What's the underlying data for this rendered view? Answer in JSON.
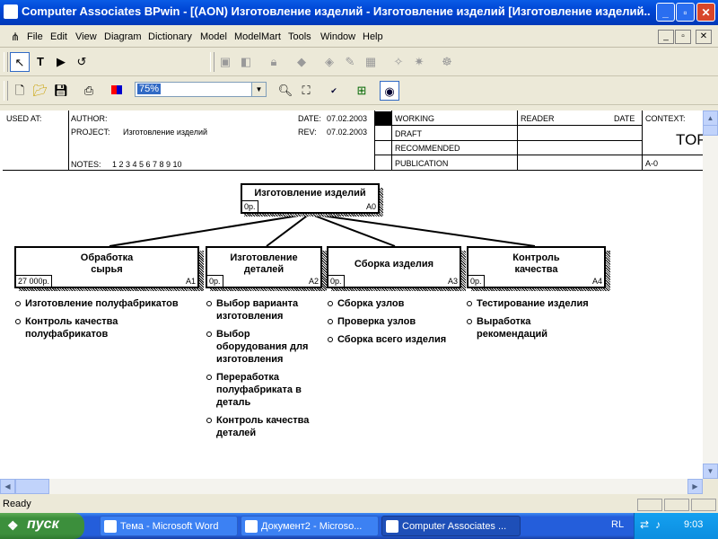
{
  "window": {
    "title": "Computer Associates BPwin - [(AON) Изготовление изделий - Изготовление изделий  [Изготовление изделий...",
    "minimize": "_",
    "maximize": "▫",
    "close": "✕"
  },
  "menu": {
    "items": [
      "File",
      "Edit",
      "View",
      "Diagram",
      "Dictionary",
      "Model",
      "ModelMart",
      "Tools",
      "Window",
      "Help"
    ],
    "mdi_min": "_",
    "mdi_restore": "▫",
    "mdi_close": "✕"
  },
  "toolbar2": {
    "zoom": "75%"
  },
  "header": {
    "used_at": "USED AT:",
    "author": "AUTHOR:",
    "project_label": "PROJECT:",
    "project": "Изготовление изделий",
    "notes_label": "NOTES:",
    "notes_numbers": "1  2  3  4  5  6  7  8  9  10",
    "date_label": "DATE:",
    "date": "07.02.2003",
    "rev_label": "REV:",
    "rev": "07.02.2003",
    "statuses": [
      "WORKING",
      "DRAFT",
      "RECOMMENDED",
      "PUBLICATION"
    ],
    "reader": "READER",
    "date_col": "DATE",
    "context": "CONTEXT:",
    "top": "TOP",
    "node": "A-0"
  },
  "diagram": {
    "root": {
      "title": "Изготовление изделий",
      "cost": "0р.",
      "num": "A0"
    },
    "boxes": [
      {
        "title": "Обработка сырья",
        "line1": "Обработка",
        "line2": "сырья",
        "cost": "27 000р.",
        "num": "A1"
      },
      {
        "title": "Изготовление деталей",
        "line1": "Изготовление",
        "line2": "деталей",
        "cost": "0р.",
        "num": "A2"
      },
      {
        "title": "Сборка изделия",
        "line1": "Сборка изделия",
        "line2": "",
        "cost": "0р.",
        "num": "A3"
      },
      {
        "title": "Контроль качества",
        "line1": "Контроль",
        "line2": "качества",
        "cost": "0р.",
        "num": "A4"
      }
    ],
    "bullets": {
      "a1": [
        "Изготовление полуфабрикатов",
        "Контроль качества полуфабрикатов"
      ],
      "a2": [
        "Выбор  варианта изготовления",
        "Выбор оборудования для изготовления",
        "Переработка полуфабриката в деталь",
        "Контроль качества деталей"
      ],
      "a3": [
        "Сборка узлов",
        "Проверка узлов",
        "Сборка всего изделия"
      ],
      "a4": [
        "Тестирование изделия",
        "Выработка рекомендаций"
      ]
    }
  },
  "status": {
    "text": "Ready"
  },
  "taskbar": {
    "start": "пуск",
    "tasks": [
      "Тема - Microsoft Word",
      "Документ2 - Microso...",
      "Computer Associates ..."
    ],
    "lang": "RL",
    "clock": "9:03"
  }
}
